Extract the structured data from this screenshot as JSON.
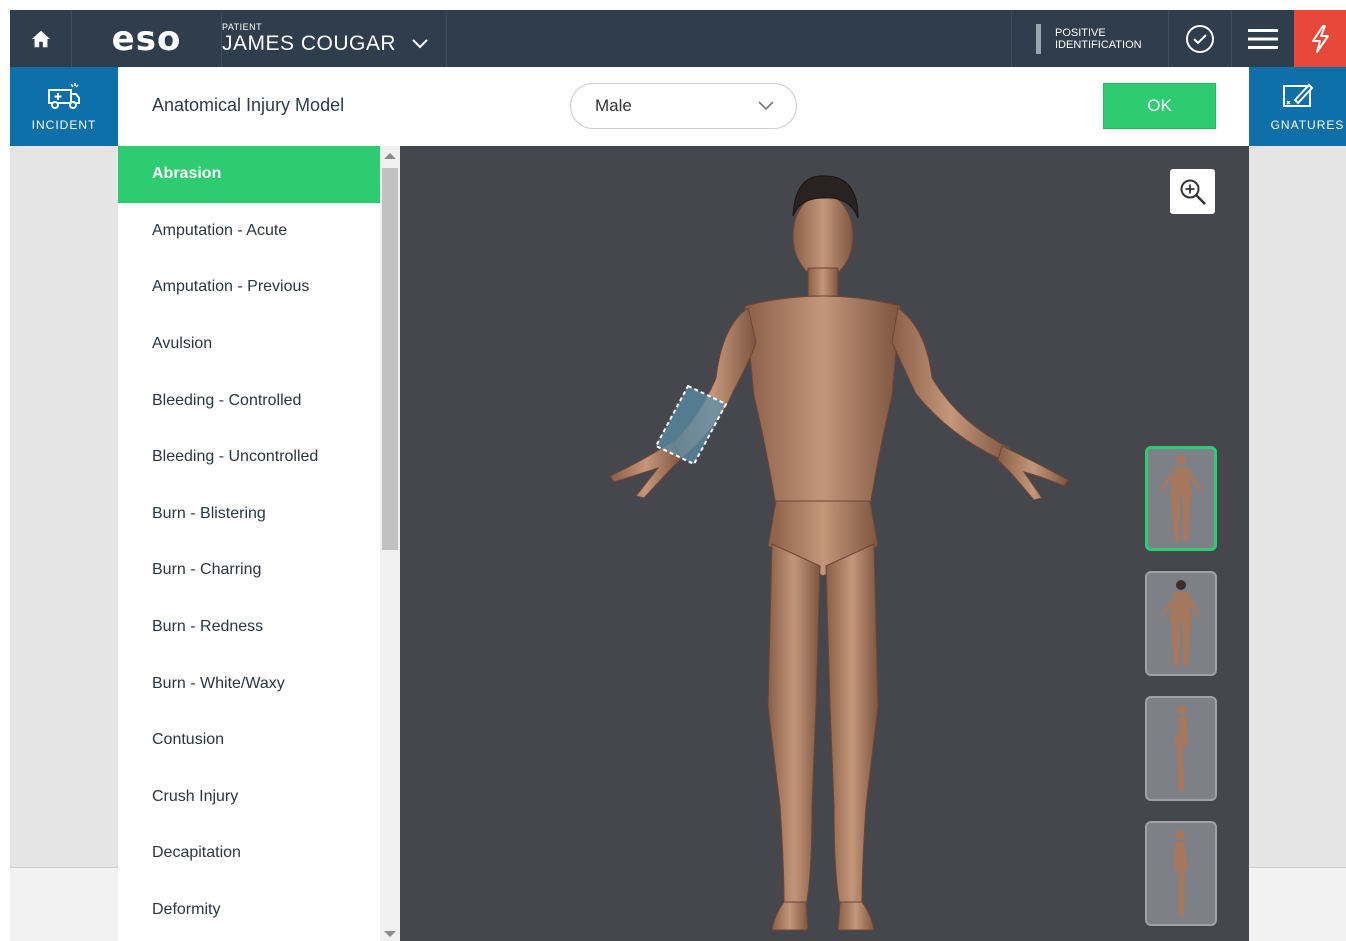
{
  "topbar": {
    "logo": "eso",
    "patient_label": "PATIENT",
    "patient_name": "JAMES COUGAR",
    "positive_id_line1": "POSITIVE",
    "positive_id_line2": "IDENTIFICATION"
  },
  "nav": {
    "left_label": "INCIDENT",
    "right_label": "GNATURES"
  },
  "modal": {
    "title": "Anatomical Injury Model",
    "gender_select": "Male",
    "ok_label": "OK"
  },
  "injury_list": [
    "Abrasion",
    "Amputation - Acute",
    "Amputation - Previous",
    "Avulsion",
    "Bleeding - Controlled",
    "Bleeding - Uncontrolled",
    "Burn - Blistering",
    "Burn - Charring",
    "Burn - Redness",
    "Burn - White/Waxy",
    "Contusion",
    "Crush Injury",
    "Decapitation",
    "Deformity"
  ],
  "selected_injury": "Abrasion",
  "icons": {
    "home": "home-icon",
    "chevron": "chevron-down-icon",
    "check": "check-circle-icon",
    "menu": "hamburger-menu-icon",
    "alert": "lightning-bolt-icon",
    "zoom": "zoom-in-icon",
    "incident": "ambulance-icon",
    "signatures": "signature-icon"
  },
  "colors": {
    "topbar": "#2f3d4c",
    "subrow": "#0f6fa8",
    "accent_green": "#2ecc71",
    "alert_red": "#e8483a",
    "viewer_bg": "#46464d",
    "skin": "#b5866a"
  }
}
